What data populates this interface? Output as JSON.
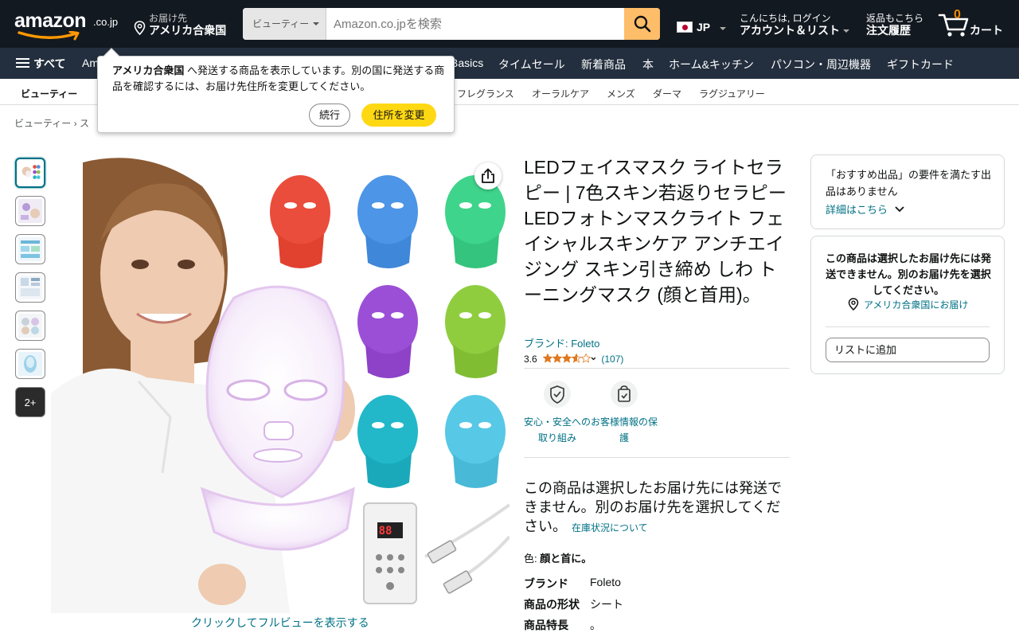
{
  "header": {
    "logo_text": "amazon",
    "logo_tld": ".co.jp",
    "deliver_label": "お届け先",
    "deliver_location": "アメリカ合衆国",
    "search_category": "ビューティー",
    "search_placeholder": "Amazon.co.jpを検索",
    "language": "JP",
    "account_greeting": "こんにちは, ログイン",
    "account_label": "アカウント＆リスト",
    "orders_top": "返品もこちら",
    "orders_label": "注文履歴",
    "cart_count": "0",
    "cart_label": "カート"
  },
  "main_nav": {
    "all_label": "すべて",
    "items": [
      "Am",
      "Basics",
      "タイムセール",
      "新着商品",
      "本",
      "ホーム&キッチン",
      "パソコン・周辺機器",
      "ギフトカード"
    ]
  },
  "sub_nav": {
    "items": [
      "ビューティー",
      "フレグランス",
      "オーラルケア",
      "メンズ",
      "ダーマ",
      "ラグジュアリー"
    ]
  },
  "breadcrumb": "ビューティー › ス",
  "popover": {
    "message_bold": "アメリカ合衆国",
    "message_rest": " へ発送する商品を表示しています。別の国に発送する商品を確認するには、お届け先住所を変更してください。",
    "continue_label": "続行",
    "change_label": "住所を変更"
  },
  "gallery": {
    "more_label": "2+",
    "fullview_label": "クリックしてフルビューを表示する",
    "panel_display": "88"
  },
  "product": {
    "title": "LEDフェイスマスク ライトセラピー | 7色スキン若返りセラピー LEDフォトンマスクライト フェイシャルスキンケア アンチエイジング スキン引き締め しわ トーニングマスク (顔と首用)。",
    "brand_link": "ブランド: Foleto",
    "rating_value": "3.6",
    "rating_count": "(107)",
    "badge_safety": "安心・安全への取り組み",
    "badge_privacy": "お客様情報の保護",
    "unavailable_text": "この商品は選択したお届け先には発送できません。別のお届け先を選択してください。",
    "stock_link": "在庫状況について",
    "color_label": "色:",
    "color_value": "顔と首に。",
    "specs": [
      {
        "key": "ブランド",
        "value": "Foleto"
      },
      {
        "key": "商品の形状",
        "value": "シート"
      },
      {
        "key": "商品特長",
        "value": "。"
      }
    ]
  },
  "buybox": {
    "no_featured": "「おすすめ出品」の要件を満たす出品はありません",
    "details_link": "詳細はこちら",
    "cannot_ship": "この商品は選択したお届け先には発送できません。別のお届け先を選択してください。",
    "ship_to": "アメリカ合衆国にお届け",
    "add_to_list": "リストに追加"
  },
  "colors": {
    "nav_dark": "#131921",
    "nav_secondary": "#232f3e",
    "accent_orange": "#febd69",
    "button_yellow": "#ffd814",
    "link_teal": "#007185",
    "star_orange": "#de7921"
  }
}
